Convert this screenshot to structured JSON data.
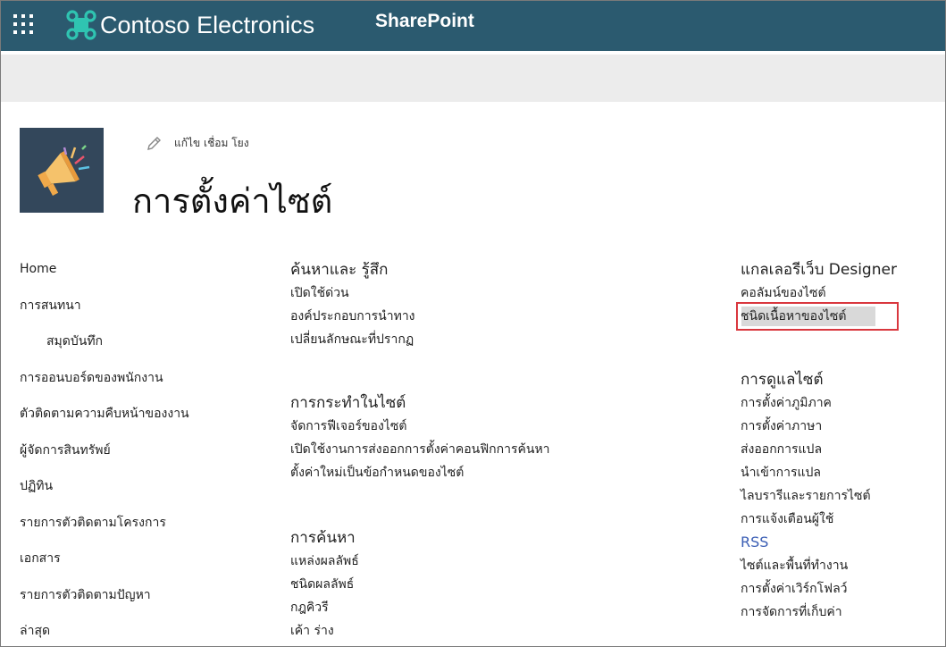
{
  "suitebar": {
    "brand_name": "Contoso Electronics",
    "app_name": "SharePoint",
    "background": "#2b5a6f",
    "brand_color": "#2fc4b1"
  },
  "site": {
    "edit_links_label": "แก้ไข  เชื่อม โยง",
    "page_title": "การตั้งค่าไซต์"
  },
  "quick_launch": [
    {
      "label": "Home",
      "indent": false
    },
    {
      "label": "การสนทนา",
      "indent": false
    },
    {
      "label": "สมุดบันทึก",
      "indent": true
    },
    {
      "label": "การออนบอร์ดของพนักงาน",
      "indent": false
    },
    {
      "label": "ตัวติดตามความคืบหน้าของงาน",
      "indent": false
    },
    {
      "label": "ผู้จัดการสินทรัพย์",
      "indent": false
    },
    {
      "label": "ปฏิทิน",
      "indent": false
    },
    {
      "label": "รายการตัวติดตามโครงการ",
      "indent": false
    },
    {
      "label": "เอกสาร",
      "indent": false
    },
    {
      "label": "รายการตัวติดตามปัญหา",
      "indent": false
    },
    {
      "label": "ล่าสุด",
      "indent": false
    }
  ],
  "sections": {
    "look_and_feel": {
      "title": "ค้นหาและ   รู้สึก",
      "links": [
        "เปิดใช้ด่วน",
        "องค์ประกอบการนำทาง",
        "เปลี่ยนลักษณะที่ปรากฏ"
      ]
    },
    "site_actions": {
      "title": "การกระทำในไซต์",
      "links": [
        "จัดการฟีเจอร์ของไซต์",
        "เปิดใช้งานการส่งออกการตั้งค่าคอนฟิกการค้นหา",
        "ตั้งค่าใหม่เป็นข้อกำหนดของไซต์"
      ]
    },
    "search": {
      "title": "การค้นหา",
      "links": [
        "แหล่งผลลัพธ์",
        "ชนิดผลลัพธ์",
        "กฎคิวรี",
        "เค้า ร่าง"
      ]
    },
    "web_designer_galleries": {
      "title": "แกลเลอรีเว็บ Designer",
      "links": [
        "คอลัมน์ของไซต์",
        "ชนิดเนื้อหาของไซต์"
      ],
      "highlighted_link": "ชนิดเนื้อหาของไซต์",
      "highlight_color": "#d9373e"
    },
    "site_administration": {
      "title": "การดูแลไซต์",
      "links": [
        "การตั้งค่าภูมิภาค",
        "การตั้งค่าภาษา",
        "ส่งออกการแปล",
        "นำเข้าการแปล",
        "ไลบรารีและรายการไซต์",
        "การแจ้งเตือนผู้ใช้",
        "RSS",
        "ไซต์และพื้นที่ทำงาน",
        "การตั้งค่าเวิร์กโฟลว์",
        "การจัดการที่เก็บค่า"
      ],
      "rss_color": "#3c5fb5"
    }
  }
}
